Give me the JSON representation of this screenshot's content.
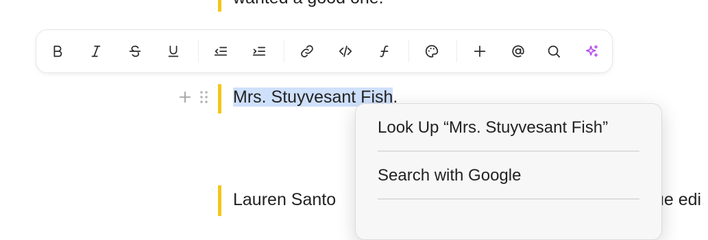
{
  "editor": {
    "top_line_text": "wanted a good one.",
    "selected_text": "Mrs. Stuyvesant Fish",
    "after_selection": ".",
    "lower_line_left": "Lauren Santo",
    "lower_line_right": "ue edi",
    "accent_color": "#f5c518",
    "selection_color": "#cfe0fb"
  },
  "toolbar": {
    "buttons": [
      {
        "name": "bold",
        "icon": "bold-icon"
      },
      {
        "name": "italic",
        "icon": "italic-icon"
      },
      {
        "name": "strikethrough",
        "icon": "strikethrough-icon"
      },
      {
        "name": "underline",
        "icon": "underline-icon"
      },
      {
        "name": "outdent",
        "icon": "outdent-icon"
      },
      {
        "name": "indent",
        "icon": "indent-icon"
      },
      {
        "name": "link",
        "icon": "link-icon"
      },
      {
        "name": "code",
        "icon": "code-icon"
      },
      {
        "name": "function",
        "icon": "function-icon"
      },
      {
        "name": "color",
        "icon": "palette-icon"
      },
      {
        "name": "insert",
        "icon": "plus-icon"
      },
      {
        "name": "mention",
        "icon": "at-icon"
      },
      {
        "name": "search",
        "icon": "search-icon"
      },
      {
        "name": "ai",
        "icon": "sparkle-icon",
        "color": "#b44cf0"
      }
    ]
  },
  "context_menu": {
    "items": [
      {
        "label": "Look Up “Mrs. Stuyvesant Fish”"
      },
      {
        "label": "Search with Google"
      }
    ]
  }
}
